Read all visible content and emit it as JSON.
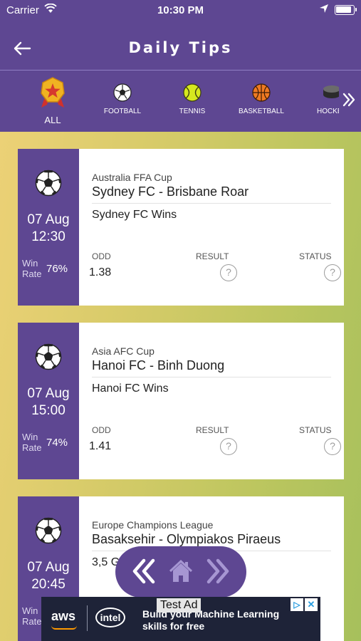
{
  "status_bar": {
    "carrier": "Carrier",
    "time": "10:30 PM"
  },
  "header": {
    "title": "Daily Tips"
  },
  "tabs": [
    {
      "label": "ALL",
      "icon": "trophy-badge-icon"
    },
    {
      "label": "FOOTBALL",
      "icon": "soccer-ball-icon"
    },
    {
      "label": "TENNIS",
      "icon": "tennis-ball-icon"
    },
    {
      "label": "BASKETBALL",
      "icon": "basketball-icon"
    },
    {
      "label": "HOCKE",
      "icon": "hockey-puck-icon"
    }
  ],
  "columns": {
    "odd": "ODD",
    "result": "RESULT",
    "status": "STATUS"
  },
  "win_rate_label": "Win\nRate",
  "tips": [
    {
      "date": "07 Aug",
      "time": "12:30",
      "win_rate": "76%",
      "league": "Australia FFA Cup",
      "teams": "Sydney FC - Brisbane Roar",
      "pick": "Sydney FC Wins",
      "odd": "1.38",
      "result": "?",
      "status": "?"
    },
    {
      "date": "07 Aug",
      "time": "15:00",
      "win_rate": "74%",
      "league": "Asia AFC Cup",
      "teams": "Hanoi FC - Binh Duong",
      "pick": "Hanoi FC Wins",
      "odd": "1.41",
      "result": "?",
      "status": "?"
    },
    {
      "date": "07 Aug",
      "time": "20:45",
      "win_rate": "",
      "league": "Europe Champions League",
      "teams": "Basaksehir - Olympiakos Piraeus",
      "pick": "3,5 G",
      "odd": "",
      "result": "",
      "status": ""
    }
  ],
  "ad": {
    "badge": "Test Ad",
    "text": "Build your Machine Learning skills for free",
    "brand1": "aws",
    "brand2": "intel"
  },
  "colors": {
    "primary": "#5e4792",
    "gradient_start": "#ecd176",
    "gradient_end": "#a6c05c"
  }
}
